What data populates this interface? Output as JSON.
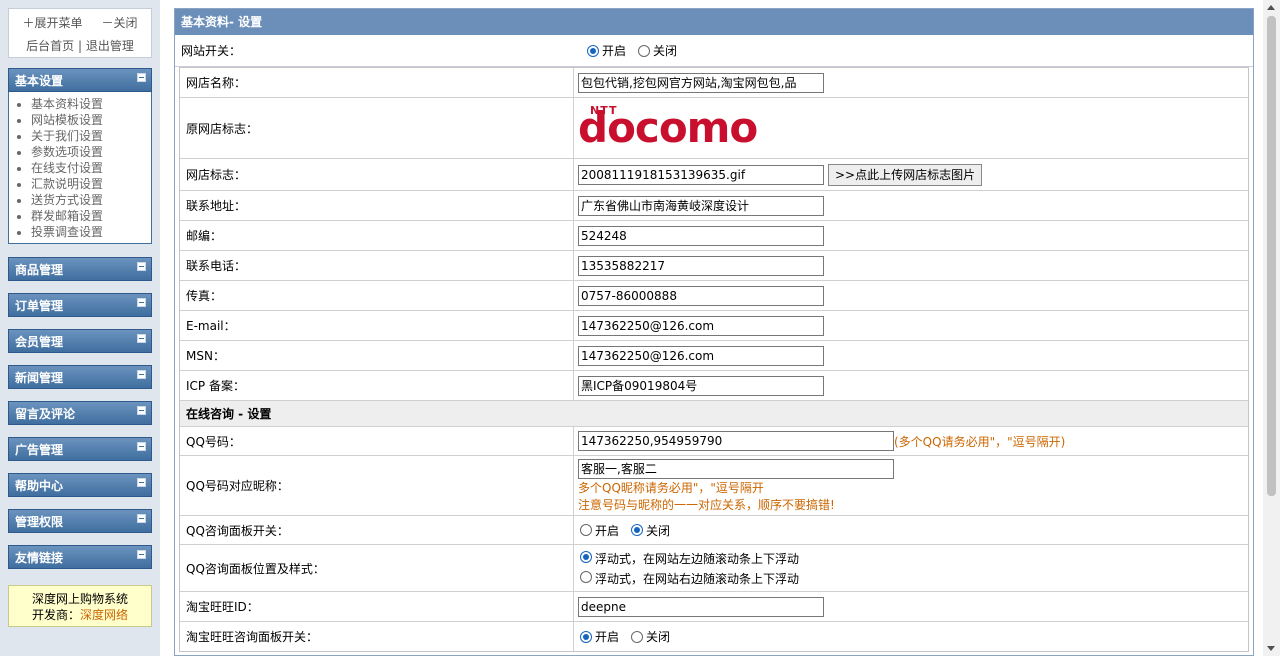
{
  "sidebar": {
    "expand": "＋展开菜单",
    "close": "－关闭",
    "home": "后台首页",
    "sep": "|",
    "logout": "退出管理",
    "sections": [
      {
        "title": "基本设置",
        "items": [
          "基本资料设置",
          "网站模板设置",
          "关于我们设置",
          "参数选项设置",
          "在线支付设置",
          "汇款说明设置",
          "送货方式设置",
          "群发邮箱设置",
          "投票调查设置"
        ]
      },
      {
        "title": "商品管理"
      },
      {
        "title": "订单管理"
      },
      {
        "title": "会员管理"
      },
      {
        "title": "新闻管理"
      },
      {
        "title": "留言及评论"
      },
      {
        "title": "广告管理"
      },
      {
        "title": "帮助中心"
      },
      {
        "title": "管理权限"
      },
      {
        "title": "友情链接"
      }
    ],
    "info_line1": "深度网上购物系统",
    "info_dev_label": "开发商：",
    "info_dev_name": "深度网络"
  },
  "main": {
    "title": "基本资料- 设置",
    "switch_label": "网站开关：",
    "on": "开启",
    "off": "关闭",
    "shop_name_label": "网店名称：",
    "shop_name": "包包代销,挖包网官方网站,淘宝网包包,品",
    "old_logo_label": "原网店标志：",
    "logo_small": "NTT",
    "logo_text": "docomo",
    "logo_label": "网店标志：",
    "logo_file": "2008111918153139635.gif",
    "upload_btn": ">>点此上传网店标志图片",
    "address_label": "联系地址：",
    "address": "广东省佛山市南海黄岐深度设计",
    "zip_label": "邮编：",
    "zip": "524248",
    "phone_label": "联系电话：",
    "phone": "13535882217",
    "fax_label": "传真：",
    "fax": "0757-86000888",
    "email_label": "E-mail：",
    "email": "147362250@126.com",
    "msn_label": "MSN：",
    "msn": "147362250@126.com",
    "icp_label": "ICP 备案：",
    "icp": "黑ICP备09019804号",
    "consult_section": "在线咨询 - 设置",
    "qq_label": "QQ号码：",
    "qq": "147362250,954959790",
    "qq_hint": "(多个QQ请务必用\"，\"逗号隔开)",
    "qq_nick_label": "QQ号码对应昵称：",
    "qq_nick": "客服一,客服二",
    "qq_nick_hint1": "多个QQ昵称请务必用\"，\"逗号隔开",
    "qq_nick_hint2": "注意号码与昵称的一一对应关系，顺序不要搞错!",
    "qq_panel_label": "QQ咨询面板开关：",
    "qq_pos_label": "QQ咨询面板位置及样式：",
    "pos_left": "浮动式，在网站左边随滚动条上下浮动",
    "pos_right": "浮动式，在网站右边随滚动条上下浮动",
    "ww_id_label": "淘宝旺旺ID：",
    "ww_id": "deepne",
    "ww_panel_label": "淘宝旺旺咨询面板开关："
  }
}
